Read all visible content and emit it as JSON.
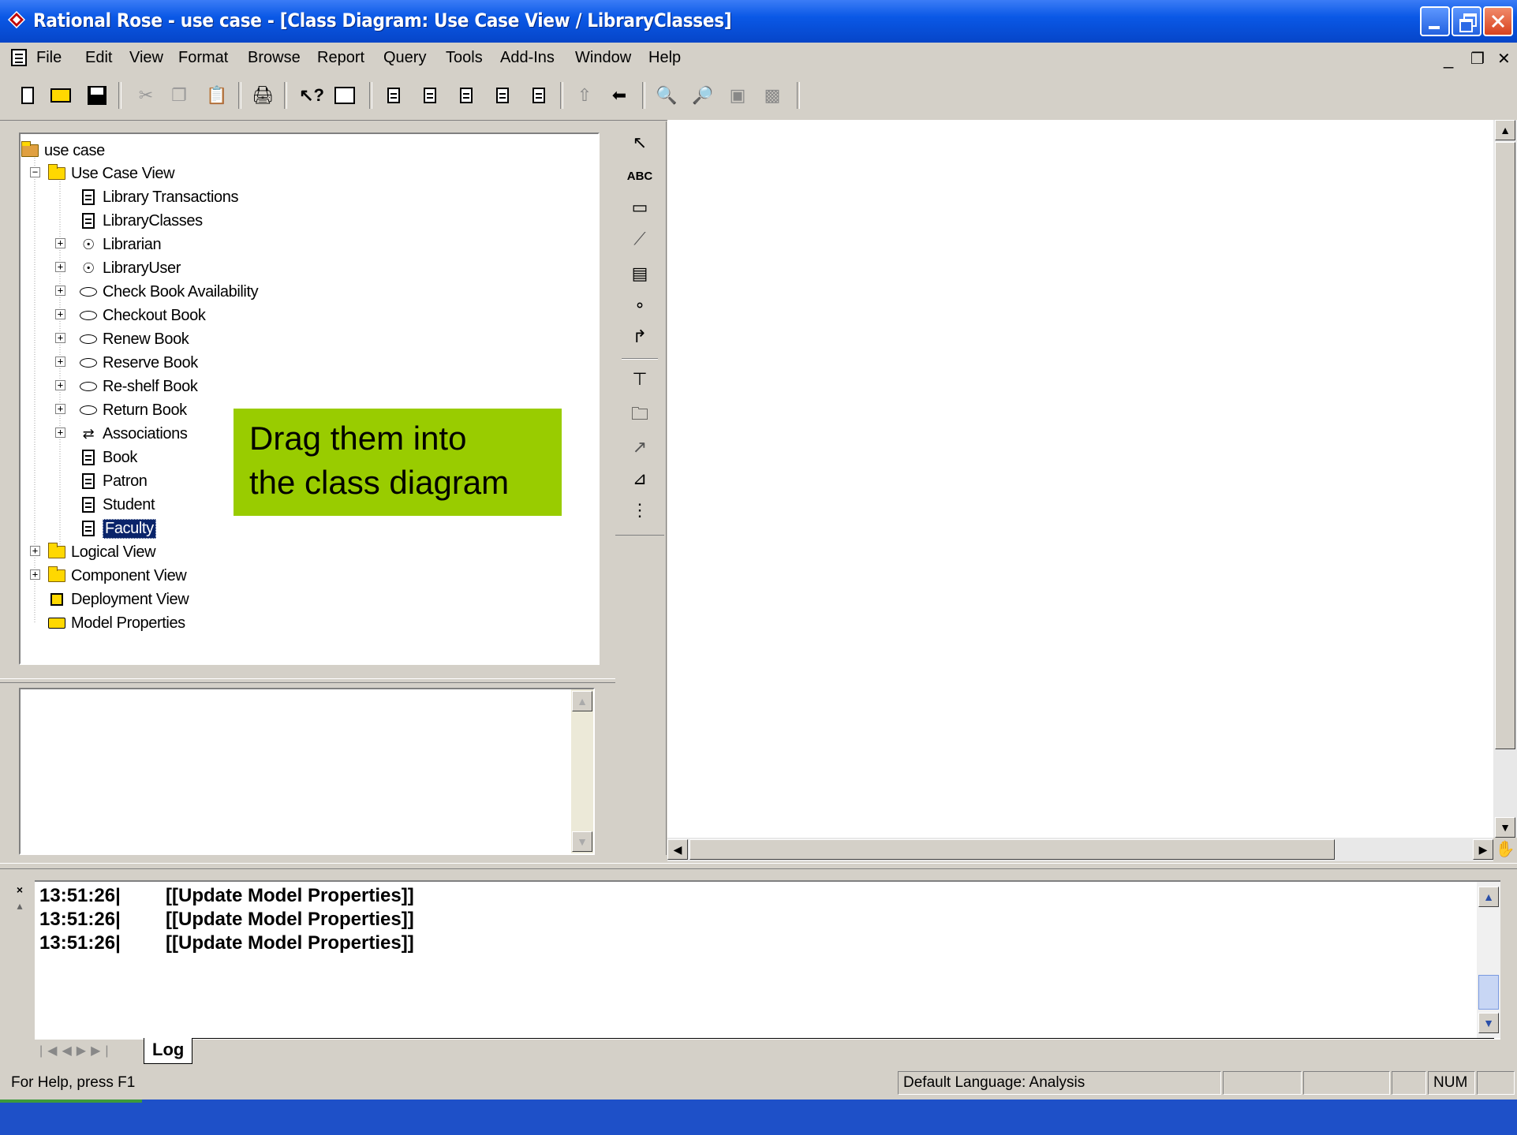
{
  "window": {
    "title": "Rational Rose - use case - [Class Diagram: Use Case View / LibraryClasses]"
  },
  "menu": {
    "items": [
      "File",
      "Edit",
      "View",
      "Format",
      "Browse",
      "Report",
      "Query",
      "Tools",
      "Add-Ins",
      "Window",
      "Help"
    ]
  },
  "toolbar": {
    "icons": [
      "new-icon",
      "open-icon",
      "save-icon",
      "cut-icon",
      "copy-icon",
      "paste-icon",
      "print-icon",
      "context-help-icon",
      "view-browser-icon",
      "class-diagram-icon",
      "use-case-diagram-icon",
      "component-diagram-icon",
      "state-diagram-icon",
      "deployment-diagram-icon",
      "browse-parent-icon",
      "previous-diagram-icon",
      "zoom-in-icon",
      "zoom-out-icon",
      "fit-window-icon",
      "undo-fit-icon"
    ]
  },
  "browser": {
    "root": "use case",
    "use_case_view": "Use Case View",
    "children": [
      "Library Transactions",
      "LibraryClasses",
      "Librarian",
      "LibraryUser",
      "Check Book Availability",
      "Checkout Book",
      "Renew Book",
      "Reserve Book",
      "Re-shelf Book",
      "Return Book",
      "Associations",
      "Book",
      "Patron",
      "Student",
      "Faculty"
    ],
    "logical_view": "Logical View",
    "component_view": "Component View",
    "deployment_view": "Deployment View",
    "model_properties": "Model Properties"
  },
  "callout": {
    "line1": "Drag them into",
    "line2": "the class diagram",
    "color": "#99cc00"
  },
  "toolbox": {
    "abc_label": "ABC"
  },
  "log": {
    "lines": [
      {
        "time": "13:51:26|",
        "msg": "[[Update Model Properties]]"
      },
      {
        "time": "13:51:26|",
        "msg": "[[Update Model Properties]]"
      },
      {
        "time": "13:51:26|",
        "msg": "[[Update Model Properties]]"
      }
    ],
    "tab": "Log"
  },
  "status": {
    "help": "For Help, press F1",
    "language": "Default Language: Analysis",
    "num": "NUM"
  }
}
